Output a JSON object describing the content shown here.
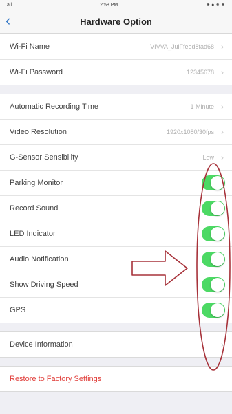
{
  "status_bar": {
    "carrier": "all",
    "time": "2:58 PM",
    "battery": "⁕ ● ⁕ ⁕"
  },
  "nav": {
    "back_icon": "chevron-left-icon",
    "title": "Hardware Option"
  },
  "wifi": [
    {
      "label": "Wi-Fi Name",
      "value": "VIVVA_JuiFfeed8fad68"
    },
    {
      "label": "Wi-Fi Password",
      "value": "12345678"
    }
  ],
  "recording": [
    {
      "label": "Automatic Recording Time",
      "value": "1 Minute"
    },
    {
      "label": "Video Resolution",
      "value": "1920x1080/30fps"
    },
    {
      "label": "G-Sensor Sensibility",
      "value": "Low"
    }
  ],
  "toggles": [
    {
      "label": "Parking Monitor",
      "on": true
    },
    {
      "label": "Record Sound",
      "on": true
    },
    {
      "label": "LED Indicator",
      "on": true
    },
    {
      "label": "Audio Notification",
      "on": true
    },
    {
      "label": "Show Driving Speed",
      "on": true
    },
    {
      "label": "GPS",
      "on": true
    }
  ],
  "device": {
    "label": "Device Information"
  },
  "restore": {
    "label": "Restore to Factory Settings"
  },
  "colors": {
    "accent": "#3478c6",
    "toggle_on": "#4cd964",
    "danger": "#e1403c",
    "annotation": "#a7323a"
  }
}
